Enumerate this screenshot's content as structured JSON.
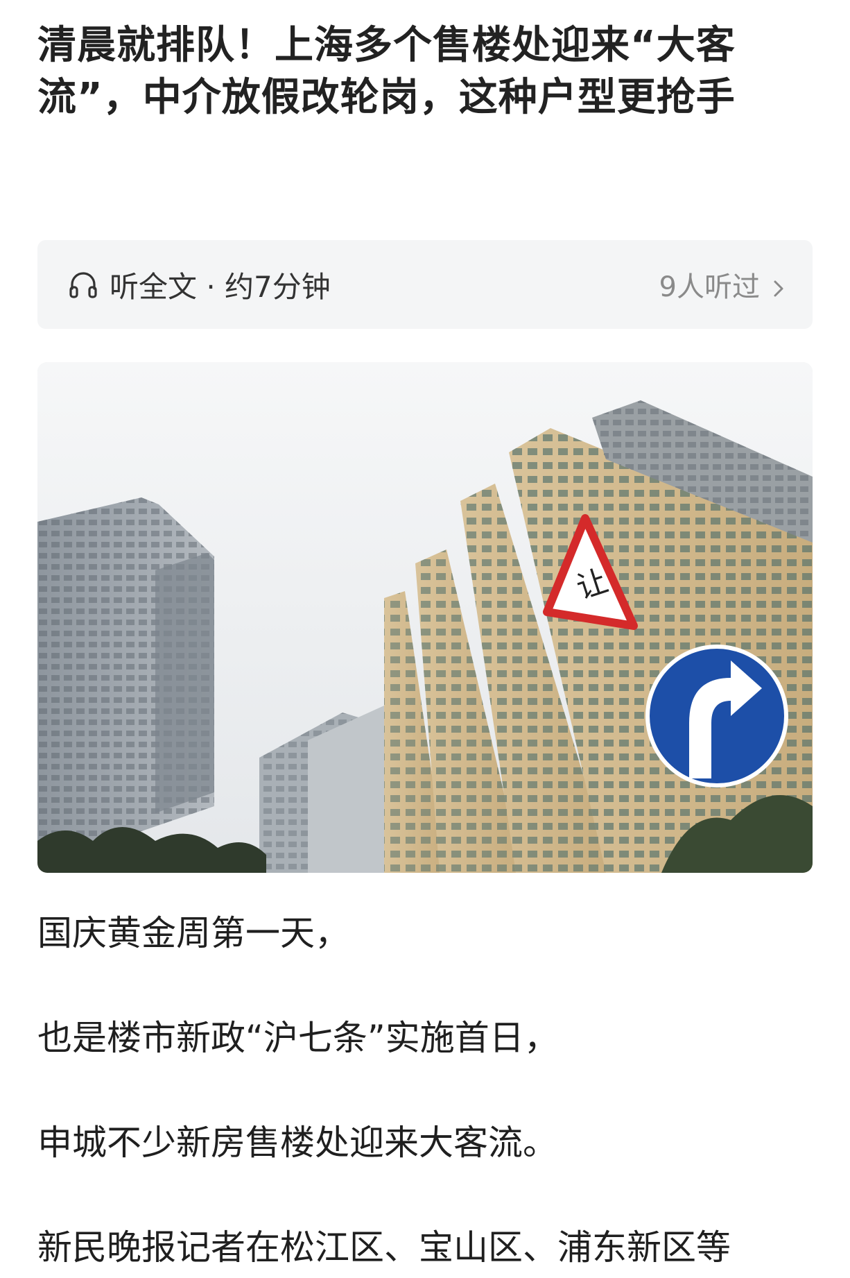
{
  "article": {
    "headline": "清晨就排队！上海多个售楼处迎来“大客流”，中介放假改轮岗，这种户型更抢手"
  },
  "audio": {
    "icon": "headphones-icon",
    "listen_label": "听全文 · 约7分钟",
    "listeners_label": "9人听过",
    "chevron_icon": "chevron-right-icon"
  },
  "hero_image": {
    "sign_text": "让"
  },
  "body": {
    "paragraphs": [
      "国庆黄金周第一天，",
      "也是楼市新政“沪七条”实施首日，",
      "申城不少新房售楼处迎来大客流。",
      "新民晚报记者在松江区、宝山区、浦东新区等"
    ]
  },
  "colors": {
    "audio_bar_bg": "#f4f5f6",
    "text_primary": "#1a1a1a",
    "text_muted": "#8a8a8a",
    "sign_blue": "#1d4fa8",
    "sign_red": "#d42a2a"
  }
}
